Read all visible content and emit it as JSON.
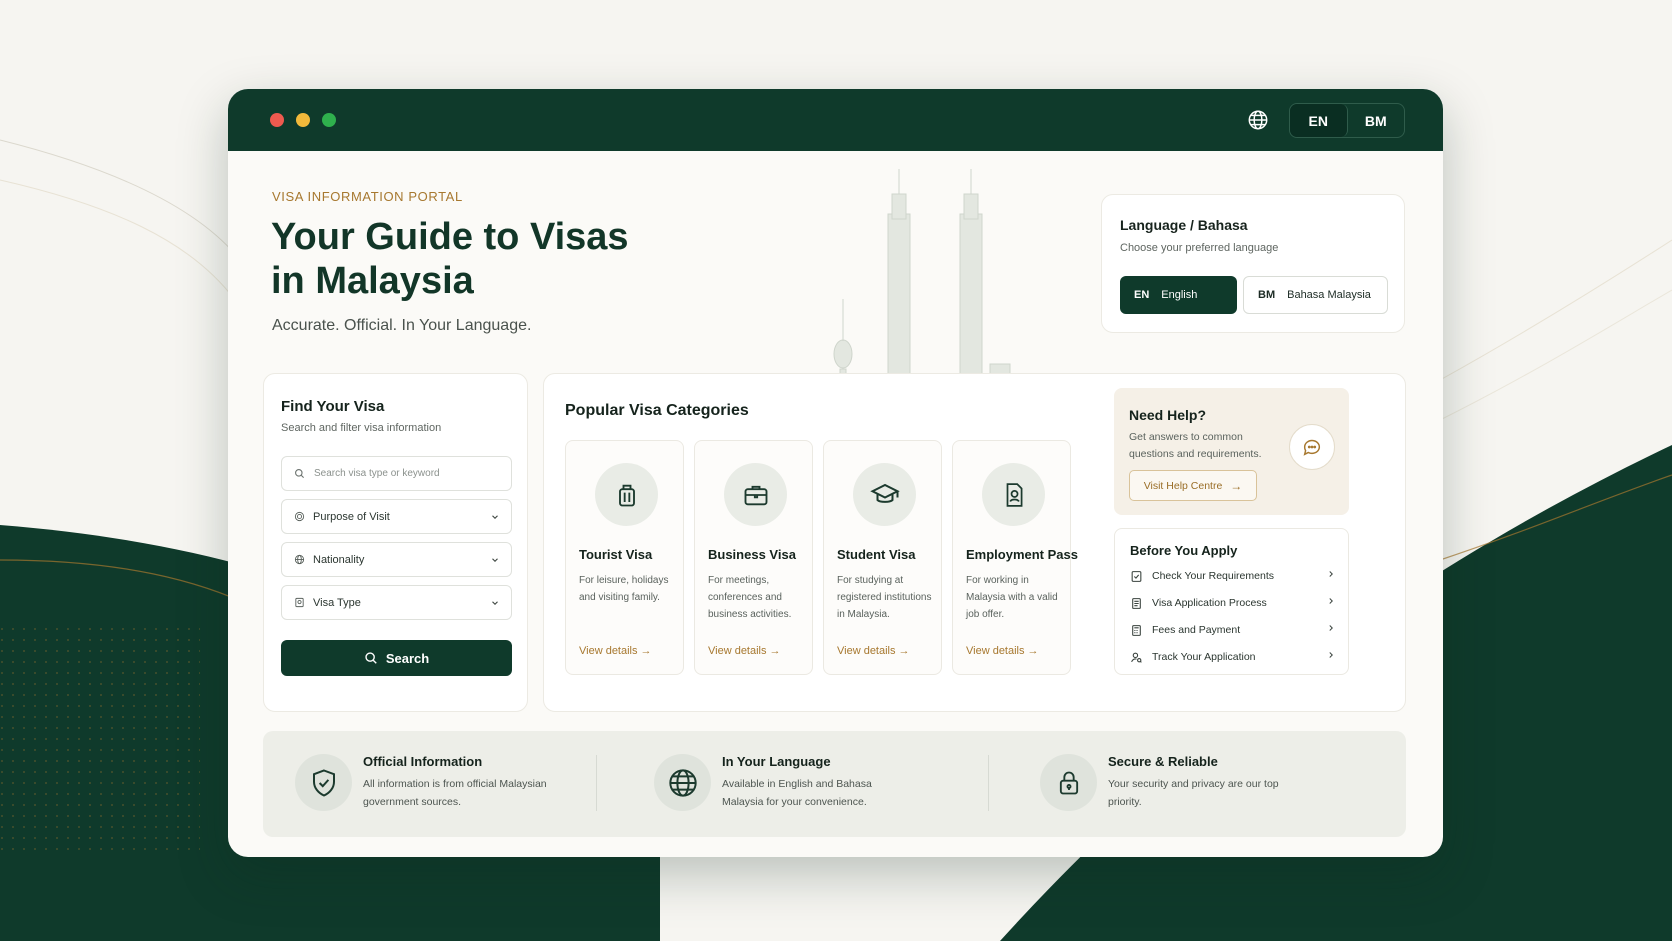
{
  "colors": {
    "brand_green": "#0f3a2b",
    "accent_gold": "#a7782f",
    "background": "#f6f5f1"
  },
  "titlebar": {
    "lang_options": [
      "EN",
      "BM"
    ],
    "active_lang": "EN",
    "globe_icon": "globe-icon"
  },
  "hero": {
    "eyebrow": "VISA INFORMATION PORTAL",
    "title": "Your Guide to Visas in Malaysia",
    "subtitle": "Accurate. Official. In Your Language."
  },
  "language_card": {
    "title": "Language / Bahasa",
    "subtitle": "Choose your preferred language",
    "options": [
      {
        "code": "EN",
        "label": "English",
        "selected": true
      },
      {
        "code": "BM",
        "label": "Bahasa Malaysia",
        "selected": false
      }
    ]
  },
  "find_visa": {
    "title": "Find Your Visa",
    "subtitle": "Search and filter visa information",
    "search_placeholder": "Search visa type or keyword",
    "filters": [
      {
        "label": "Purpose of Visit",
        "icon": "target-icon"
      },
      {
        "label": "Nationality",
        "icon": "globe-icon"
      },
      {
        "label": "Visa Type",
        "icon": "passport-icon"
      }
    ],
    "search_button": "Search"
  },
  "popular": {
    "title": "Popular Visa Categories",
    "categories": [
      {
        "name": "Tourist Visa",
        "desc": "For leisure, holidays and visiting family.",
        "link": "View details",
        "icon": "luggage-icon"
      },
      {
        "name": "Business Visa",
        "desc": "For meetings, conferences and business activities.",
        "link": "View details",
        "icon": "briefcase-icon"
      },
      {
        "name": "Student Visa",
        "desc": "For studying at registered institutions in Malaysia.",
        "link": "View details",
        "icon": "graduation-cap-icon"
      },
      {
        "name": "Employment Pass",
        "desc": "For working in Malaysia with a valid job offer.",
        "link": "View details",
        "icon": "id-badge-icon"
      }
    ]
  },
  "help": {
    "title": "Need Help?",
    "text": "Get answers to common questions and requirements.",
    "button": "Visit Help Centre"
  },
  "before_apply": {
    "title": "Before You Apply",
    "items": [
      {
        "label": "Check Your Requirements",
        "icon": "checklist-icon"
      },
      {
        "label": "Visa Application Process",
        "icon": "document-icon"
      },
      {
        "label": "Fees and Payment",
        "icon": "calculator-icon"
      },
      {
        "label": "Track Your Application",
        "icon": "user-search-icon"
      }
    ]
  },
  "features": [
    {
      "title": "Official Information",
      "text": "All information is from official Malaysian government sources.",
      "icon": "shield-check-icon"
    },
    {
      "title": "In Your Language",
      "text": "Available in English and Bahasa Malaysia for your convenience.",
      "icon": "globe-icon"
    },
    {
      "title": "Secure & Reliable",
      "text": "Your security and privacy are our top priority.",
      "icon": "lock-icon"
    }
  ]
}
